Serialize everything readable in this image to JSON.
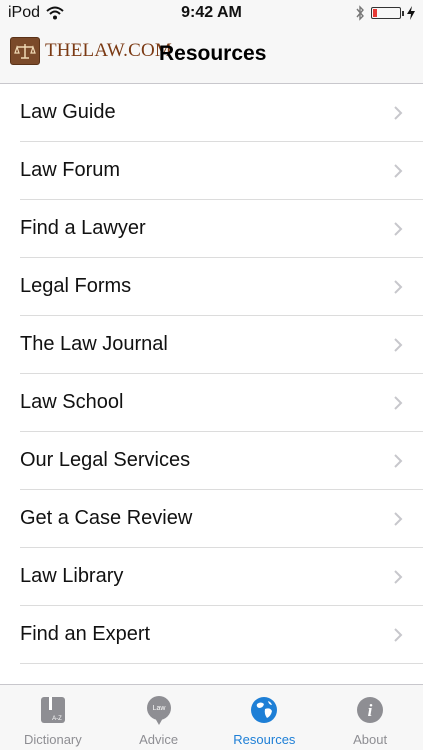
{
  "status_bar": {
    "device": "iPod",
    "time": "9:42 AM"
  },
  "nav": {
    "logo_text": "THELAW.COM",
    "title": "Resources"
  },
  "list": {
    "items": [
      {
        "label": "Law Guide"
      },
      {
        "label": "Law Forum"
      },
      {
        "label": "Find a Lawyer"
      },
      {
        "label": "Legal Forms"
      },
      {
        "label": "The Law Journal"
      },
      {
        "label": "Law School"
      },
      {
        "label": "Our Legal Services"
      },
      {
        "label": "Get a Case Review"
      },
      {
        "label": "Law Library"
      },
      {
        "label": "Find an Expert"
      }
    ]
  },
  "tab_bar": {
    "tabs": [
      {
        "label": "Dictionary",
        "icon": "dictionary-book-icon",
        "icon_text": "A-Z"
      },
      {
        "label": "Advice",
        "icon": "advice-bubble-icon",
        "icon_text": "Law"
      },
      {
        "label": "Resources",
        "icon": "globe-icon",
        "active": true
      },
      {
        "label": "About",
        "icon": "info-icon",
        "icon_text": "i"
      }
    ]
  },
  "colors": {
    "accent": "#1e7fd6",
    "inactive_tab": "#8e8e93",
    "logo_brown": "#7b3a14",
    "battery_low": "#e53935"
  }
}
